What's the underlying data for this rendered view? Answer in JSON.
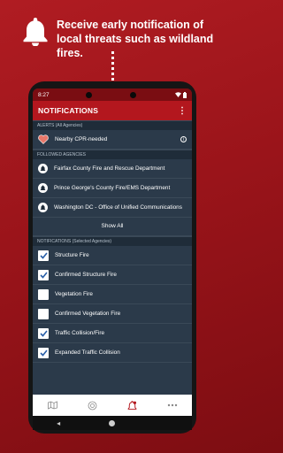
{
  "promo": {
    "headline": "Receive early notification of local threats such as wildland fires."
  },
  "status": {
    "time": "8:27"
  },
  "appbar": {
    "title": "NOTIFICATIONS",
    "menu_icon": "more-vert-icon"
  },
  "alerts": {
    "header": "ALERTS (All Agencies)",
    "items": [
      {
        "label": "Nearby CPR-needed"
      }
    ]
  },
  "followed": {
    "header": "FOLLOWED AGENCIES",
    "items": [
      {
        "label": "Fairfax County Fire and Rescue Department"
      },
      {
        "label": "Prince George's County Fire/EMS Department"
      },
      {
        "label": "Washington DC - Office of Unified Communications"
      }
    ],
    "show_all": "Show All"
  },
  "notifications": {
    "header": "NOTIFICATIONS (Selected Agencies)",
    "items": [
      {
        "label": "Structure Fire",
        "checked": true
      },
      {
        "label": "Confirmed Structure Fire",
        "checked": true
      },
      {
        "label": "Vegetation Fire",
        "checked": false
      },
      {
        "label": "Confirmed Vegetation Fire",
        "checked": false
      },
      {
        "label": "Traffic Collision/Fire",
        "checked": true
      },
      {
        "label": "Expanded Traffic Collision",
        "checked": true
      }
    ]
  },
  "colors": {
    "brand_red": "#b3171e",
    "panel": "#2b3a4a",
    "check_blue": "#2a5fa8"
  }
}
